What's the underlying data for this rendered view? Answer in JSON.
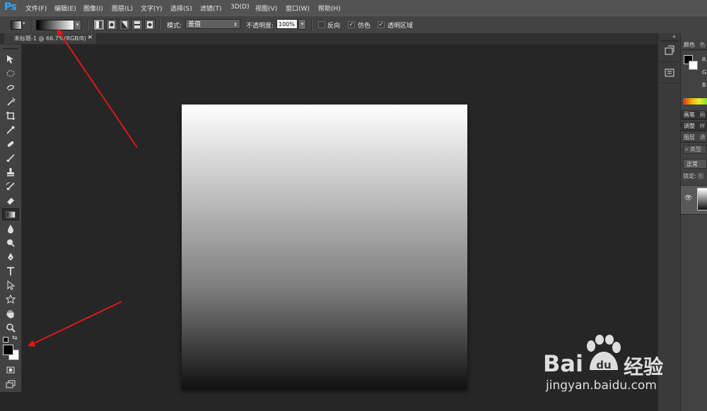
{
  "app": {
    "logo": "Ps"
  },
  "menu": [
    "文件(F)",
    "编辑(E)",
    "图像(I)",
    "图层(L)",
    "文字(Y)",
    "选择(S)",
    "滤镜(T)",
    "3D(D)",
    "视图(V)",
    "窗口(W)",
    "帮助(H)"
  ],
  "options": {
    "mode_label": "模式:",
    "mode_value": "差值",
    "opacity_label": "不透明度:",
    "opacity_value": "100%",
    "reverse_label": "反向",
    "dither_label": "仿色",
    "transparency_label": "透明区域",
    "reverse_checked": false,
    "dither_checked": true,
    "transparency_checked": true
  },
  "document": {
    "tab_title": "未标题-1 @ 66.7%(RGB/8) *",
    "close_glyph": "×"
  },
  "panels": {
    "color_tab": "颜色",
    "color_tab2": "色",
    "r": "R",
    "g": "G",
    "b": "B",
    "brush_tab": "画笔",
    "brush_tab2": "画",
    "adjust_tab": "调整",
    "adjust_tab2": "样",
    "layers_tab": "图层",
    "layers_tab2": "通",
    "filter_kind": "类型",
    "blend_mode": "正常",
    "lock_label": "锁定:",
    "lock_extra": "图"
  },
  "watermark": {
    "text": "Bai",
    "text2": "经验",
    "url": "jingyan.baidu.com"
  },
  "colors": {
    "arrow": "#e01818",
    "accent": "#31a8ff",
    "canvas_top": "#ffffff",
    "canvas_bottom": "#111111"
  }
}
